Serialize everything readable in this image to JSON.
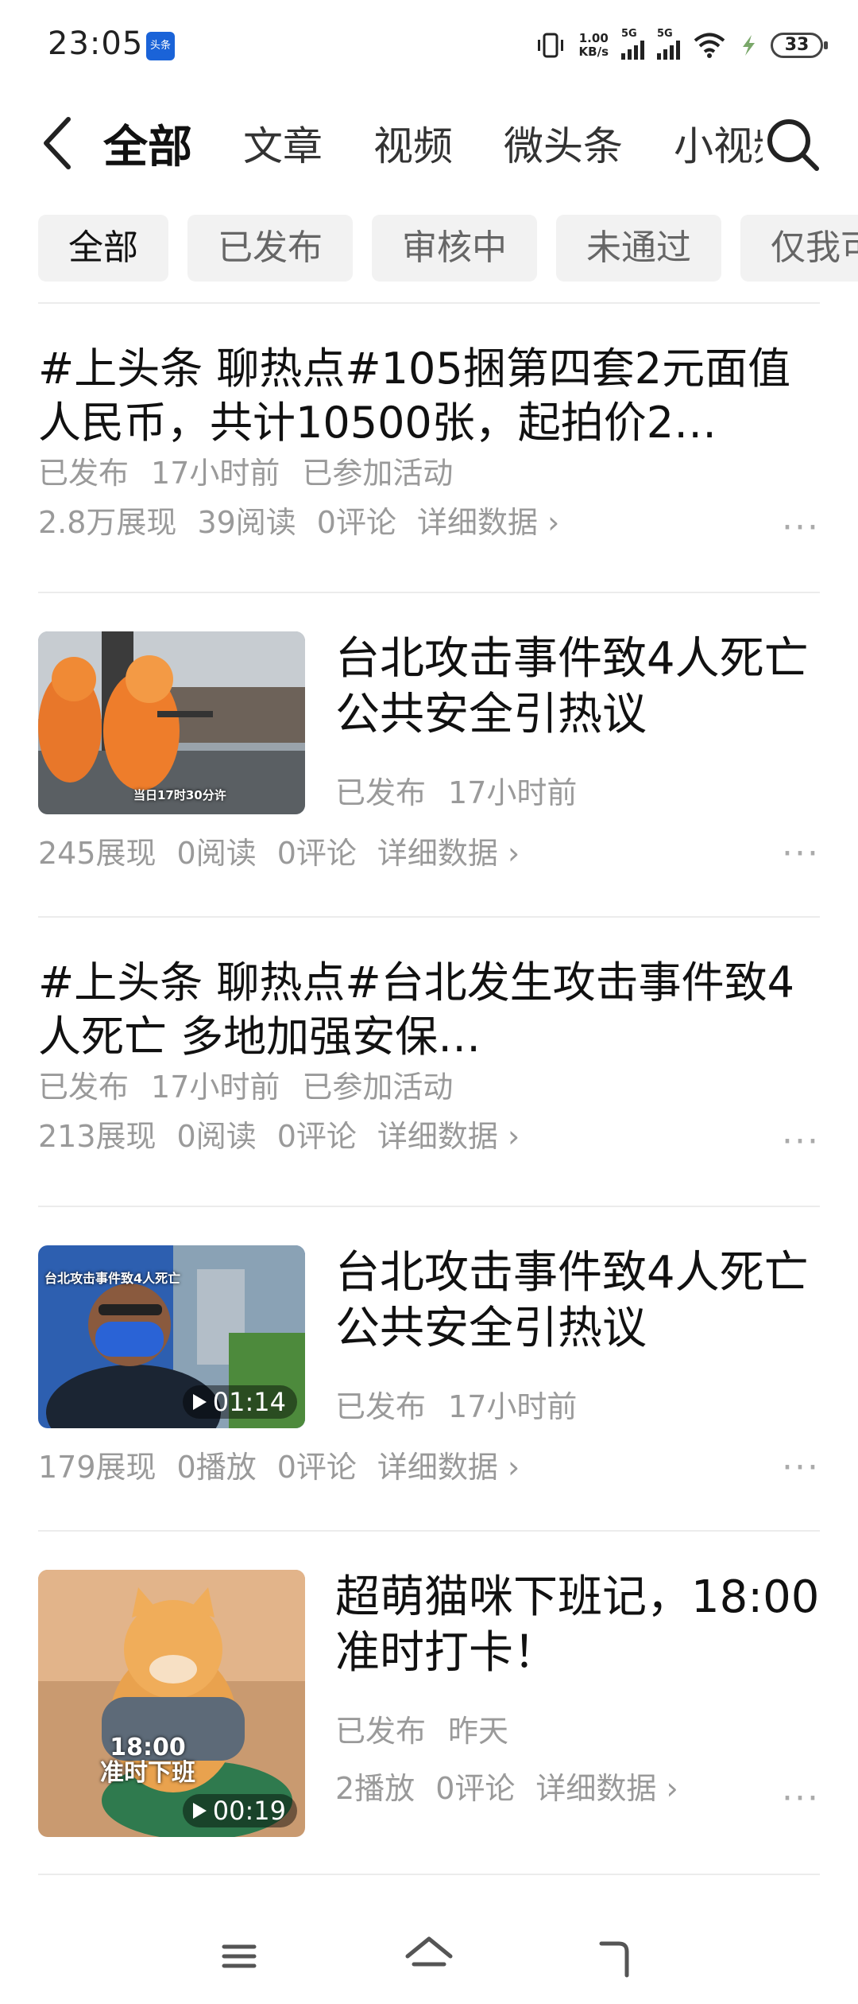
{
  "status_bar": {
    "time": "23:05",
    "app_badge": "头条",
    "net_speed_value": "1.00",
    "net_speed_unit": "KB/s",
    "sim1_label": "5G",
    "sim2_label": "5G",
    "battery": "33"
  },
  "header": {
    "tabs": [
      "全部",
      "文章",
      "视频",
      "微头条",
      "小视频"
    ]
  },
  "filters": {
    "chips": [
      "全部",
      "已发布",
      "审核中",
      "未通过",
      "仅我可见"
    ]
  },
  "items": [
    {
      "type": "text",
      "title": "#上头条 聊热点#105捆第四套2元面值人民币，共计10500张，起拍价2…",
      "status": "已发布",
      "time": "17小时前",
      "tag": "已参加活动",
      "views": "2.8万展现",
      "reads": "39阅读",
      "comments": "0评论",
      "detail": "详细数据"
    },
    {
      "type": "image",
      "title": "台北攻击事件致4人死亡 公共安全引热议",
      "thumb_caption": "当日17时30分许",
      "status": "已发布",
      "time": "17小时前",
      "views": "245展现",
      "reads": "0阅读",
      "comments": "0评论",
      "detail": "详细数据"
    },
    {
      "type": "text",
      "title": "#上头条 聊热点#台北发生攻击事件致4人死亡 多地加强安保…",
      "status": "已发布",
      "time": "17小时前",
      "tag": "已参加活动",
      "views": "213展现",
      "reads": "0阅读",
      "comments": "0评论",
      "detail": "详细数据"
    },
    {
      "type": "video",
      "title": "台北攻击事件致4人死亡 公共安全引热议",
      "thumb_caption": "台北攻击事件致4人死亡",
      "duration": "01:14",
      "status": "已发布",
      "time": "17小时前",
      "views": "179展现",
      "plays": "0播放",
      "comments": "0评论",
      "detail": "详细数据"
    },
    {
      "type": "video",
      "title": "超萌猫咪下班记，18:00准时打卡！",
      "thumb_caption_line1": "18:00",
      "thumb_caption_line2": "准时下班",
      "duration": "00:19",
      "status": "已发布",
      "time": "昨天",
      "plays": "2播放",
      "comments": "0评论",
      "detail": "详细数据"
    }
  ],
  "more_label": "···",
  "icons": {
    "back": "chevron-left-icon",
    "search": "search-icon",
    "menu": "menu-icon",
    "home": "home-icon",
    "return": "back-gesture-icon"
  }
}
